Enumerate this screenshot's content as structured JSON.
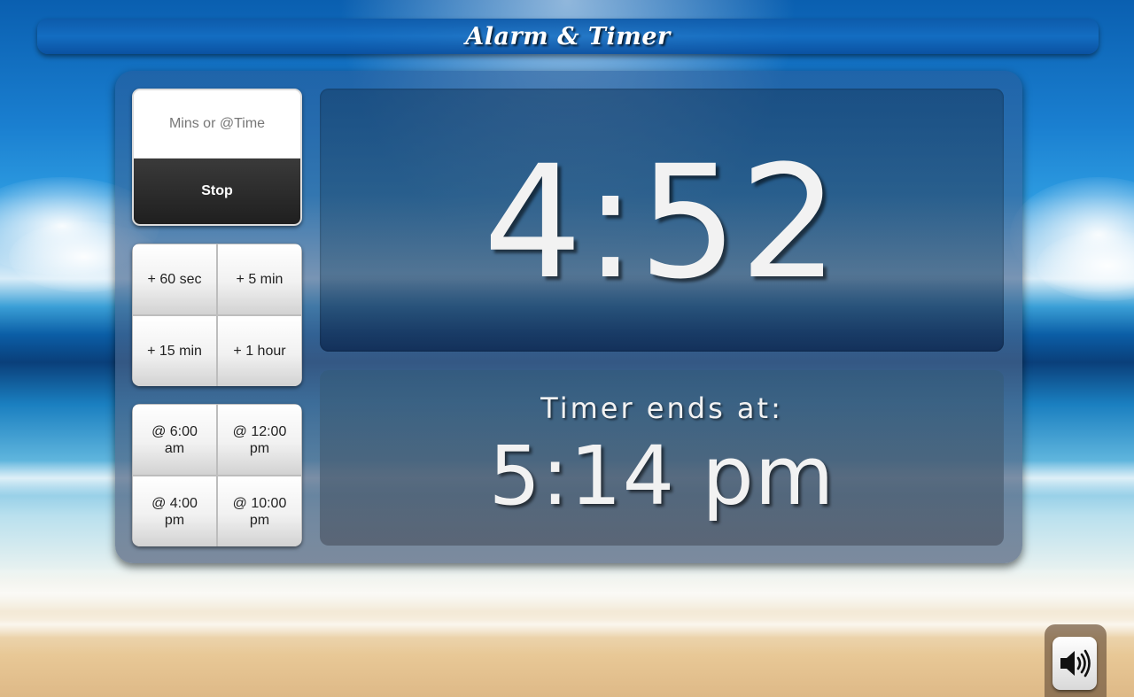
{
  "app": {
    "title": "Alarm & Timer"
  },
  "input": {
    "placeholder": "Mins or @Time",
    "value": ""
  },
  "stop_button": {
    "label": "Stop"
  },
  "quick_add": [
    {
      "label": "+ 60 sec"
    },
    {
      "label": "+ 5 min"
    },
    {
      "label": "+ 15 min"
    },
    {
      "label": "+ 1 hour"
    }
  ],
  "presets": [
    {
      "label": "@ 6:00\nam"
    },
    {
      "label": "@ 12:00\npm"
    },
    {
      "label": "@ 4:00\npm"
    },
    {
      "label": "@ 10:00\npm"
    }
  ],
  "countdown": {
    "value": "4:52"
  },
  "ends": {
    "label": "Timer ends at:",
    "time": "5:14 pm"
  },
  "sound": {
    "icon": "speaker-volume-icon"
  }
}
